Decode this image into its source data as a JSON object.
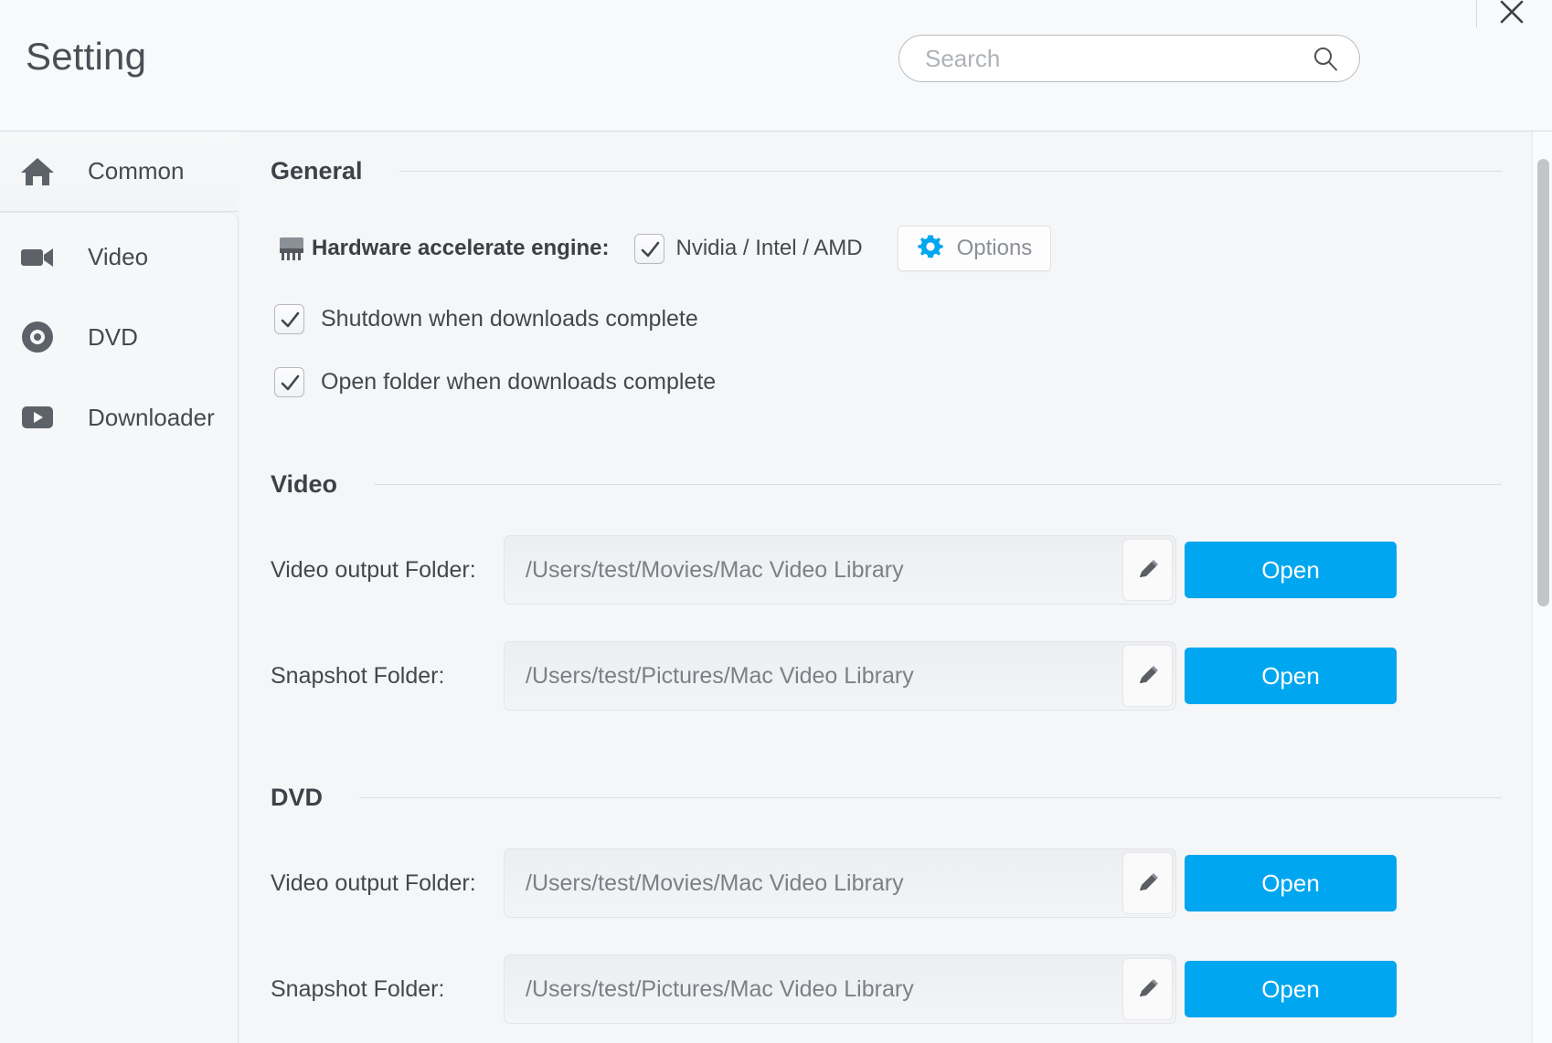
{
  "header": {
    "title": "Setting",
    "search": {
      "placeholder": "Search",
      "value": "",
      "icon": "search-icon"
    },
    "close_icon": "close-icon"
  },
  "sidebar": {
    "items": [
      {
        "label": "Common",
        "icon": "home-icon",
        "active": true
      },
      {
        "label": "Video",
        "icon": "camcorder-icon",
        "active": false
      },
      {
        "label": "DVD",
        "icon": "disc-icon",
        "active": false
      },
      {
        "label": "Downloader",
        "icon": "play-box-icon",
        "active": false
      }
    ]
  },
  "content": {
    "general": {
      "title": "General",
      "hardware": {
        "icon": "chip-icon",
        "label": "Hardware accelerate engine:",
        "checked": true,
        "engines": "Nvidia /  Intel / AMD",
        "options_label": "Options",
        "options_icon": "gear-icon"
      },
      "checkboxes": [
        {
          "label": "Shutdown when downloads complete",
          "checked": true
        },
        {
          "label": "Open folder when downloads complete",
          "checked": true
        }
      ]
    },
    "video": {
      "title": "Video",
      "rows": [
        {
          "label": "Video output Folder:",
          "path": "/Users/test/Movies/Mac Video Library",
          "edit_icon": "pencil-icon",
          "open_label": "Open"
        },
        {
          "label": "Snapshot Folder:",
          "path": "/Users/test/Pictures/Mac Video Library",
          "edit_icon": "pencil-icon",
          "open_label": "Open"
        }
      ]
    },
    "dvd": {
      "title": "DVD",
      "rows": [
        {
          "label": "Video output Folder:",
          "path": "/Users/test/Movies/Mac Video Library",
          "edit_icon": "pencil-icon",
          "open_label": "Open"
        },
        {
          "label": "Snapshot Folder:",
          "path": "/Users/test/Pictures/Mac Video Library",
          "edit_icon": "pencil-icon",
          "open_label": "Open"
        }
      ]
    }
  },
  "colors": {
    "accent_blue": "#00a6ef",
    "gear_blue": "#00a6ef",
    "text_dark": "#44484e",
    "text_muted": "#7b8087",
    "panel_bg": "#f4f6f8"
  }
}
